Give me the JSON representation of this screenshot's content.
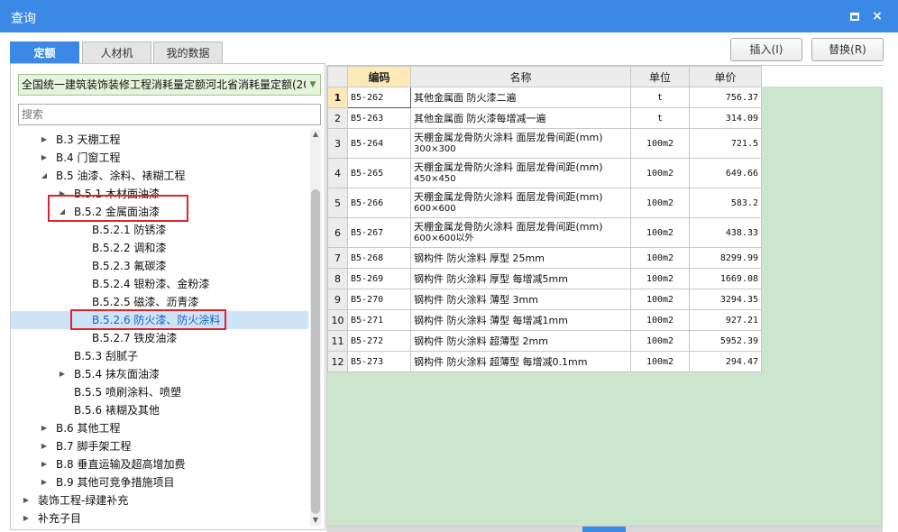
{
  "window": {
    "title": "查询",
    "max_icon": "maximize-icon",
    "close_icon": "×"
  },
  "tabs": [
    {
      "label": "定额",
      "active": true
    },
    {
      "label": "人材机",
      "active": false
    },
    {
      "label": "我的数据",
      "active": false
    }
  ],
  "buttons": {
    "insert": "插入(I)",
    "replace": "替换(R)"
  },
  "left": {
    "library_select": "全国统一建筑装饰装修工程消耗量定额河北省消耗量定额(20",
    "search_placeholder": "搜索",
    "tree": [
      {
        "label": "B.3 天棚工程",
        "arrow": "▶"
      },
      {
        "label": "B.4 门窗工程",
        "arrow": "▶"
      },
      {
        "label": "B.5 油漆、涂料、裱糊工程",
        "arrow": "◢"
      },
      {
        "label": "B.5.1 木材面油漆",
        "arrow": "▶"
      },
      {
        "label": "B.5.2 金属面油漆",
        "arrow": "◢"
      },
      {
        "label": "B.5.2.1 防锈漆",
        "arrow": ""
      },
      {
        "label": "B.5.2.2 调和漆",
        "arrow": ""
      },
      {
        "label": "B.5.2.3 氟碳漆",
        "arrow": ""
      },
      {
        "label": "B.5.2.4 银粉漆、金粉漆",
        "arrow": ""
      },
      {
        "label": "B.5.2.5 磁漆、沥青漆",
        "arrow": ""
      },
      {
        "label": "B.5.2.6 防火漆、防火涂料",
        "arrow": ""
      },
      {
        "label": "B.5.2.7 铁皮油漆",
        "arrow": ""
      },
      {
        "label": "B.5.3 刮腻子",
        "arrow": ""
      },
      {
        "label": "B.5.4 抹灰面油漆",
        "arrow": "▶"
      },
      {
        "label": "B.5.5 喷刷涂料、喷塑",
        "arrow": ""
      },
      {
        "label": "B.5.6 裱糊及其他",
        "arrow": ""
      },
      {
        "label": "B.6 其他工程",
        "arrow": "▶"
      },
      {
        "label": "B.7 脚手架工程",
        "arrow": "▶"
      },
      {
        "label": "B.8 垂直运输及超高增加费",
        "arrow": "▶"
      },
      {
        "label": "B.9 其他可竞争措施项目",
        "arrow": "▶"
      },
      {
        "label": "装饰工程-绿建补充",
        "arrow": "▶"
      },
      {
        "label": "补充子目",
        "arrow": "▶"
      }
    ]
  },
  "grid": {
    "headers": {
      "code": "编码",
      "name": "名称",
      "unit": "单位",
      "price": "单价"
    },
    "rows": [
      {
        "n": "1",
        "code": "B5-262",
        "name": "其他金属面 防火漆二遍",
        "name2": "",
        "unit": "t",
        "price": "756.37"
      },
      {
        "n": "2",
        "code": "B5-263",
        "name": "其他金属面 防火漆每增减一遍",
        "name2": "",
        "unit": "t",
        "price": "314.09"
      },
      {
        "n": "3",
        "code": "B5-264",
        "name": "天棚金属龙骨防火涂料 面层龙骨间距(mm)",
        "name2": "300×300",
        "unit": "100m2",
        "price": "721.5"
      },
      {
        "n": "4",
        "code": "B5-265",
        "name": "天棚金属龙骨防火涂料 面层龙骨间距(mm)",
        "name2": "450×450",
        "unit": "100m2",
        "price": "649.66"
      },
      {
        "n": "5",
        "code": "B5-266",
        "name": "天棚金属龙骨防火涂料 面层龙骨间距(mm)",
        "name2": "600×600",
        "unit": "100m2",
        "price": "583.2"
      },
      {
        "n": "6",
        "code": "B5-267",
        "name": "天棚金属龙骨防火涂料 面层龙骨间距(mm)",
        "name2": "600×600以外",
        "unit": "100m2",
        "price": "438.33"
      },
      {
        "n": "7",
        "code": "B5-268",
        "name": "钢构件 防火涂料 厚型 25mm",
        "name2": "",
        "unit": "100m2",
        "price": "8299.99"
      },
      {
        "n": "8",
        "code": "B5-269",
        "name": "钢构件 防火涂料 厚型 每增减5mm",
        "name2": "",
        "unit": "100m2",
        "price": "1669.08"
      },
      {
        "n": "9",
        "code": "B5-270",
        "name": "钢构件 防火涂料 薄型 3mm",
        "name2": "",
        "unit": "100m2",
        "price": "3294.35"
      },
      {
        "n": "10",
        "code": "B5-271",
        "name": "钢构件 防火涂料 薄型 每增减1mm",
        "name2": "",
        "unit": "100m2",
        "price": "927.21"
      },
      {
        "n": "11",
        "code": "B5-272",
        "name": "钢构件 防火涂料 超薄型 2mm",
        "name2": "",
        "unit": "100m2",
        "price": "5952.39"
      },
      {
        "n": "12",
        "code": "B5-273",
        "name": "钢构件 防火涂料 超薄型 每增减0.1mm",
        "name2": "",
        "unit": "100m2",
        "price": "294.47"
      }
    ]
  },
  "colors": {
    "accent": "#3a89e6",
    "highlight_border": "#e0242c",
    "grid_bg": "#cbe6cc",
    "selected_row": "#cde4f7"
  }
}
